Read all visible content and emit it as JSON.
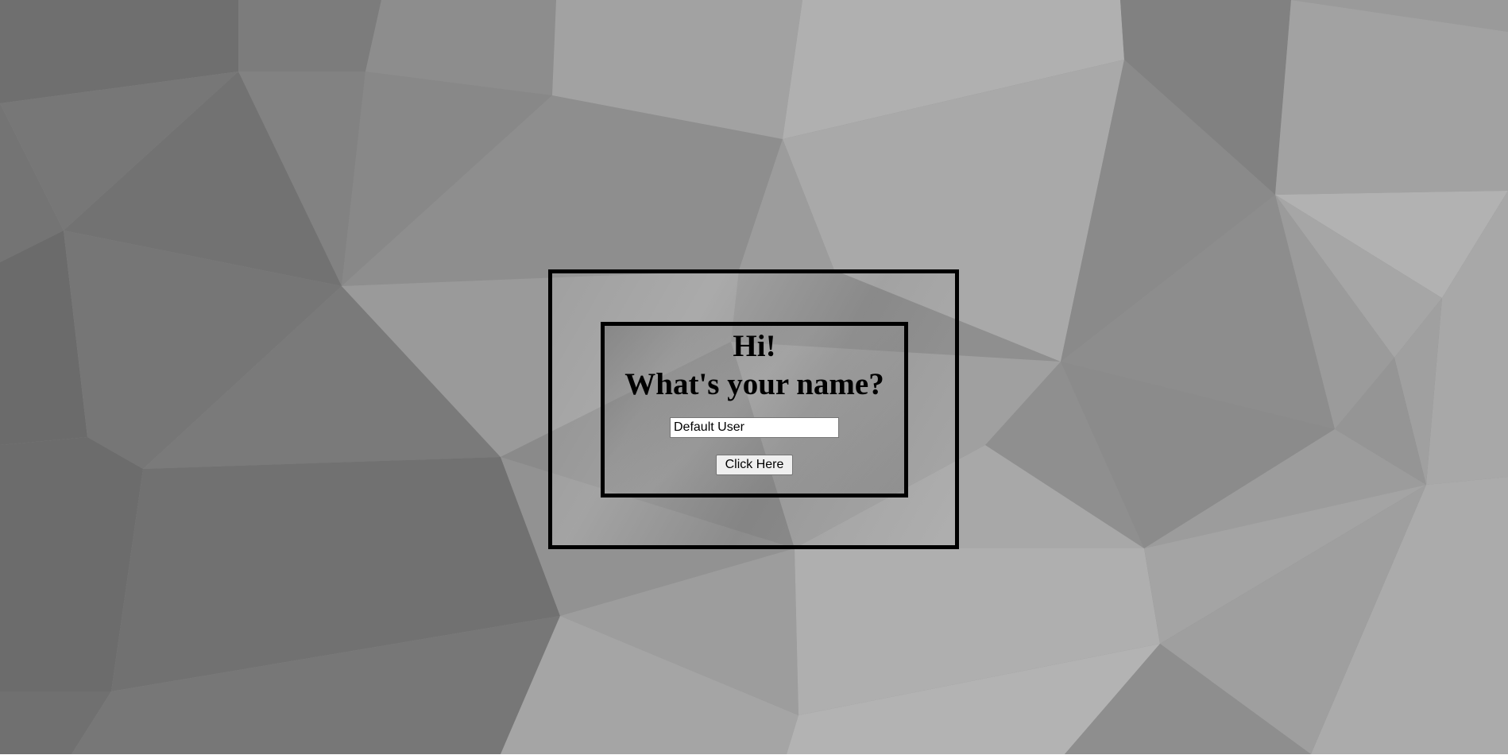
{
  "greeting": {
    "line1": "Hi!",
    "line2": "What's your name?"
  },
  "name_input": {
    "value": "Default User",
    "placeholder": ""
  },
  "submit_button": {
    "label": "Click Here"
  },
  "colors": {
    "frame_border": "#000000",
    "background_tone": "#8f8f8f",
    "page": "#ffffff"
  }
}
